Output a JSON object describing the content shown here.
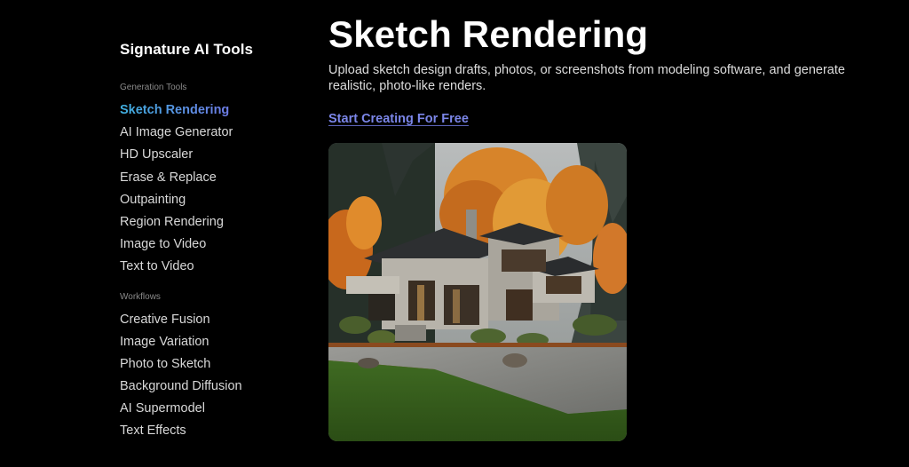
{
  "sidebar": {
    "title": "Signature AI Tools",
    "sections": [
      {
        "heading": "Generation Tools",
        "items": [
          {
            "label": "Sketch Rendering",
            "active": true
          },
          {
            "label": "AI Image Generator",
            "active": false
          },
          {
            "label": "HD Upscaler",
            "active": false
          },
          {
            "label": "Erase & Replace",
            "active": false
          },
          {
            "label": "Outpainting",
            "active": false
          },
          {
            "label": "Region Rendering",
            "active": false
          },
          {
            "label": "Image to Video",
            "active": false
          },
          {
            "label": "Text to Video",
            "active": false
          }
        ]
      },
      {
        "heading": "Workflows",
        "items": [
          {
            "label": "Creative Fusion",
            "active": false
          },
          {
            "label": "Image Variation",
            "active": false
          },
          {
            "label": "Photo to Sketch",
            "active": false
          },
          {
            "label": "Background Diffusion",
            "active": false
          },
          {
            "label": "AI Supermodel",
            "active": false
          },
          {
            "label": "Text Effects",
            "active": false
          }
        ]
      }
    ]
  },
  "main": {
    "title": "Sketch Rendering",
    "description": "Upload sketch design drafts, photos, or screenshots from modeling software, and generate realistic, photo-like renders.",
    "cta_label": "Start Creating For Free",
    "hero_image_alt": "Modern concrete house with autumn trees rendering"
  },
  "colors": {
    "background": "#000000",
    "active_gradient_start": "#3fb0e0",
    "active_gradient_end": "#8a5cf0",
    "link": "#7b86e8"
  }
}
